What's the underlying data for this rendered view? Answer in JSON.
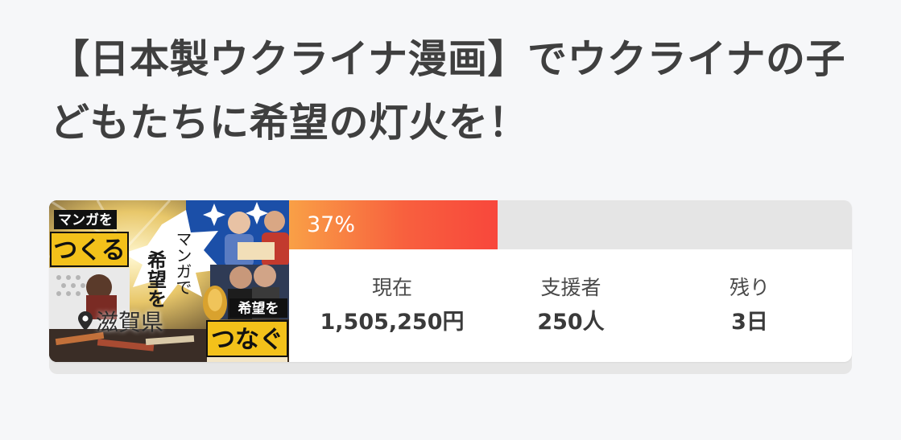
{
  "project": {
    "title": "【日本製ウクライナ漫画】でウクライナの子どもたちに希望の灯火を！",
    "location": "滋賀県",
    "thumbnail": {
      "text_top_1": "マンガを",
      "text_top_2": "つくる",
      "text_bottom_1": "希望を",
      "text_bottom_2": "つなぐ",
      "text_vertical_1": "希望を",
      "text_vertical_2": "マンガで"
    }
  },
  "progress": {
    "percent_label": "37%",
    "fraction": 0.37,
    "colors": {
      "start": "#f9a046",
      "end": "#f8473c",
      "track": "#e5e5e5"
    }
  },
  "stats": {
    "current": {
      "label": "現在",
      "value": "1,505,250円"
    },
    "supporters": {
      "label": "支援者",
      "value": "250人"
    },
    "remaining": {
      "label": "残り",
      "value": "3日"
    }
  }
}
